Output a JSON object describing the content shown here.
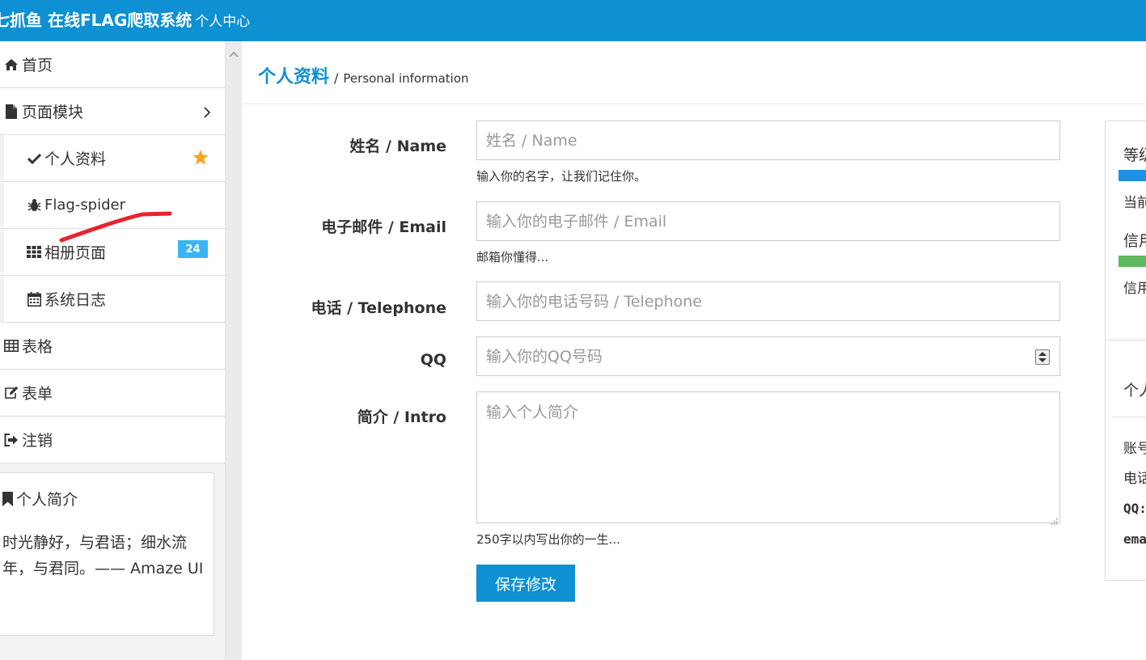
{
  "header": {
    "title": "七抓鱼 在线FLAG爬取系统",
    "subtitle": "个人中心"
  },
  "sidebar": {
    "items": [
      {
        "label": "首页",
        "icon": "home-icon"
      },
      {
        "label": "页面模块",
        "icon": "file-icon"
      },
      {
        "label": "个人资料",
        "icon": "check-icon"
      },
      {
        "label": "Flag-spider",
        "icon": "bug-icon"
      },
      {
        "label": "相册页面",
        "icon": "th-icon",
        "badge": "24"
      },
      {
        "label": "系统日志",
        "icon": "calendar-icon"
      },
      {
        "label": "表格",
        "icon": "table-icon"
      },
      {
        "label": "表单",
        "icon": "edit-icon"
      },
      {
        "label": "注销",
        "icon": "sign-out-icon"
      }
    ],
    "intro": {
      "title": "个人简介",
      "text": "时光静好，与君语；细水流年，与君同。—— Amaze UI"
    }
  },
  "page": {
    "title": "个人资料",
    "separator": "/",
    "subtitle": "Personal information"
  },
  "form": {
    "name": {
      "label": "姓名 / Name",
      "placeholder": "姓名 / Name",
      "hint": "输入你的名字，让我们记住你。"
    },
    "email": {
      "label": "电子邮件 / Email",
      "placeholder": "输入你的电子邮件 / Email",
      "hint": "邮箱你懂得..."
    },
    "phone": {
      "label": "电话 / Telephone",
      "placeholder": "输入你的电话号码 / Telephone"
    },
    "qq": {
      "label": "QQ",
      "placeholder": "输入你的QQ号码"
    },
    "intro": {
      "label": "简介 / Intro",
      "placeholder": "输入个人简介",
      "hint": "250字以内写出你的一生..."
    },
    "save_label": "保存修改"
  },
  "right_panel": {
    "level_label": "等级",
    "current_label": "当前",
    "credit_label": "信用",
    "credit_text": "信用",
    "personal_label": "个人",
    "account_label": "账号",
    "phone_label": "电话",
    "qq_label": "QQ:",
    "email_label": "email"
  },
  "colors": {
    "primary": "#0e90d2",
    "badge": "#3bb4f2",
    "star": "#f5a623",
    "progress_blue": "#1e90e6",
    "progress_green": "#5eb95e",
    "annotation": "#e8232c"
  }
}
